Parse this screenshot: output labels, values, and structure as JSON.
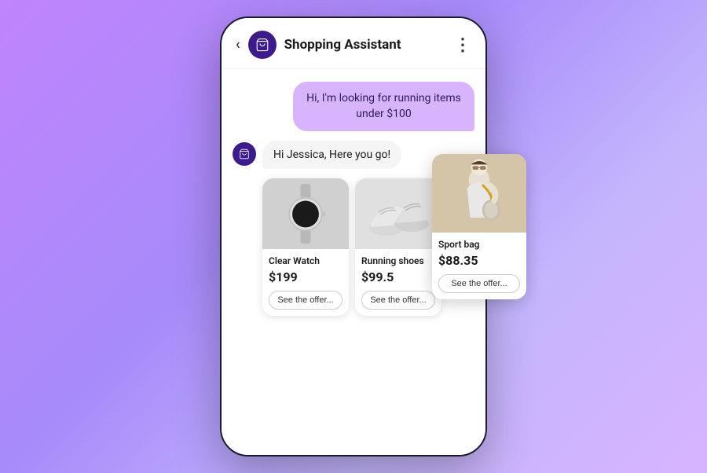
{
  "header": {
    "back_label": "‹",
    "title": "Shopping Assistant",
    "more_icon": "⋮"
  },
  "chat": {
    "user_message": "Hi, I'm looking for running items under $100",
    "bot_greeting": "Hi Jessica, Here you go!"
  },
  "products": [
    {
      "id": "watch",
      "name": "Clear Watch",
      "price": "$199",
      "offer_label": "See the offer..."
    },
    {
      "id": "shoes",
      "name": "Running shoes",
      "price": "$99.5",
      "offer_label": "See the offer..."
    }
  ],
  "floating_product": {
    "name": "Sport bag",
    "price": "$88.35",
    "offer_label": "See the offer..."
  }
}
